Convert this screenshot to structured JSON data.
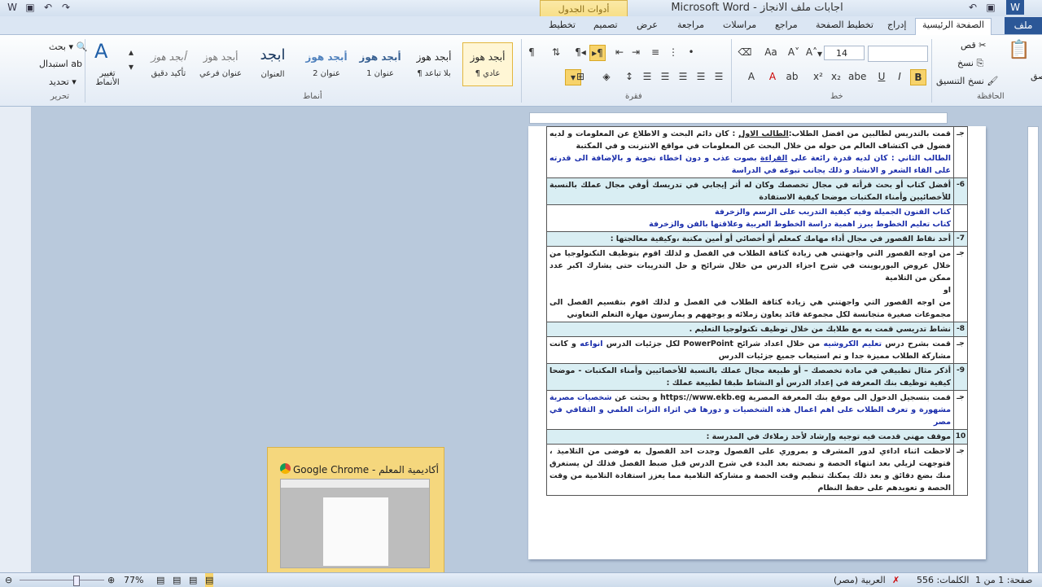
{
  "window": {
    "title": "اجابات ملف الانجاز - Microsoft Word",
    "table_tools": "أدوات الجدول"
  },
  "tabs": {
    "file": "ملف",
    "items": [
      {
        "label": "الصفحة الرئيسية",
        "active": true
      },
      {
        "label": "إدراج"
      },
      {
        "label": "تخطيط الصفحة"
      },
      {
        "label": "مراجع"
      },
      {
        "label": "مراسلات"
      },
      {
        "label": "مراجعة"
      },
      {
        "label": "عرض"
      },
      {
        "label": "تصميم"
      },
      {
        "label": "تخطيط"
      }
    ]
  },
  "ribbon": {
    "clipboard": {
      "label": "الحافظة",
      "cut": "قص",
      "copy": "نسخ",
      "format_painter": "نسخ التنسيق",
      "paste": "لصق"
    },
    "font": {
      "label": "خط",
      "size": "14",
      "bold": "B",
      "italic": "I",
      "underline": "U",
      "strike": "abe",
      "subscript": "x₂",
      "superscript": "x²"
    },
    "paragraph": {
      "label": "فقرة"
    },
    "styles": {
      "label": "أنماط",
      "items": [
        {
          "preview": "أبجد هوز",
          "name": "¶ عادي",
          "selected": true
        },
        {
          "preview": "أبجد هوز",
          "name": "¶ بلا تباعد"
        },
        {
          "preview": "أبجد هوز",
          "name": "عنوان 1"
        },
        {
          "preview": "أبجد هوز",
          "name": "عنوان 2"
        },
        {
          "preview": "ابجد",
          "name": "العنوان"
        },
        {
          "preview": "أبجد هوز",
          "name": "عنوان فرعي"
        },
        {
          "preview": "أبجد هوز",
          "name": "تأكيد دقيق"
        }
      ],
      "change_styles": "تغيير الأنماط"
    },
    "editing": {
      "label": "تحرير",
      "find": "بحث",
      "replace": "استبدال",
      "select": "تحديد"
    }
  },
  "document": {
    "rows": [
      {
        "num": "جـ",
        "type": "a",
        "parts": [
          {
            "t": "قمت بالتدريس لطالبين من افضل الطلاب:"
          },
          {
            "t": "الطالب الاول",
            "u": true
          },
          {
            "t": " : كان دائم البحث و الاطلاع عن المعلومات و لديه فضول في اكتشاف العالم من حوله من خلال البحث عن المعلومات في مواقع الانترنت و في المكتبة"
          },
          {
            "br": true
          },
          {
            "t": "الطالب الثاني : كان لديه قدرة رائعة على ",
            "c": "blue"
          },
          {
            "t": "القراءة",
            "c": "blue",
            "u": true
          },
          {
            "t": " بصوت عذب و دون اخطاء نحوية و بالإضافة الى قدرته على القاء الشعر و الانشاد و ذلك يجانب تبوغه في الدراسة",
            "c": "blue"
          }
        ]
      },
      {
        "num": "6-",
        "type": "q",
        "parts": [
          {
            "t": "أفضل كتاب أو بحث قرأته في مجال تخصصك وكان له أثر إيجابي في تدريسك أوفي مجال عملك بالنسبة للأخصائيين وأمناء المكتبات موضحا كيفية الاستفادة"
          }
        ]
      },
      {
        "num": "",
        "type": "a",
        "parts": [
          {
            "t": "كتاب الفنون الجميلة وفيه كيفية التدريب على الرسم والزخرفة",
            "c": "blue"
          },
          {
            "br": true
          },
          {
            "t": "كتاب  تعليم الخطوط   يبرز اهمية دراسة الخطوط العربية وعلاقتها بالفن  والزخرفة",
            "c": "blue"
          },
          {
            "br": true
          },
          {
            "t": " "
          }
        ]
      },
      {
        "num": "7-",
        "type": "q",
        "parts": [
          {
            "t": "أحد نقاط القصور في مجال أداء مهامك كمعلم أو أخصائي أو أمين مكتبة ،وكيفية معالجتها :"
          }
        ]
      },
      {
        "num": "جـ",
        "type": "a",
        "parts": [
          {
            "t": "من اوجه القصور التي واجهتني  هي زيادة كثافة الطلاب في الفصل و لذلك اقوم بتوظيف التكنولوجيا من خلال عروض البوربوينت في شرح اجزاء الدرس من خلال شرائح و حل التدريبات حتى يشارك اكبر عدد ممكن من التلامية"
          },
          {
            "br": true
          },
          {
            "t": "او"
          },
          {
            "br": true
          },
          {
            "t": "من اوجه القصور التي واجهتني  هي زيادة كثافة الطلاب في الفصل و لذلك اقوم بتقسيم الفصل الى مجموعات صغيرة متجانسة لكل مجموعة قائد يعاون زملائه و يوجههم و يمارسون مهارة التعلم التعاوني"
          },
          {
            "br": true
          },
          {
            "t": " "
          }
        ]
      },
      {
        "num": "8-",
        "type": "q",
        "parts": [
          {
            "t": "نشاط تدريسي قمت به مع طلابك من خلال توظيف تكنولوجيا التعليم ."
          }
        ]
      },
      {
        "num": "جـ",
        "type": "a",
        "parts": [
          {
            "t": "قمت بشرح درس "
          },
          {
            "t": "تعليم الكروشيه",
            "c": "blue"
          },
          {
            "t": " من خلال اعداد شرائح PowerPoint  لكل جزئيات الدرس "
          },
          {
            "t": "انواعه",
            "c": "blue"
          },
          {
            "t": " و كانت مشاركة الطلاب مميزة جدا و تم استيعاب جميع جزئيات الدرس"
          }
        ]
      },
      {
        "num": "9-",
        "type": "q",
        "parts": [
          {
            "t": "أذكر مثال تطبيقي في مادة تخصصك – أو طبيعة مجال عملك بالنسبة للأخصائيين وأمناء المكتبات - موضحا كيفية توظيف بنك المعرفة في إعداد الدرس أو النشاط طبقا لطبيعة عملك :"
          }
        ]
      },
      {
        "num": "جـ",
        "type": "a",
        "parts": [
          {
            "t": "قمت بتسجيل الدخول الى موقع بنك المعرفة المصرية https://www.ekb.eg و بحثت عن "
          },
          {
            "t": "شخصيات مصرية مشهورة و تعرف الطلاب على اهم اعمال هذه الشخصيات و دورها في اثراء التراث العلمي و الثقافي في مصر",
            "c": "blue"
          }
        ]
      },
      {
        "num": "10",
        "type": "q",
        "parts": [
          {
            "t": "موقف مهني قدمت فيه توجيه وإرشاد لأحد زملاءك في المدرسة :"
          }
        ]
      },
      {
        "num": "جـ",
        "type": "a",
        "parts": [
          {
            "t": "لاحظت اثناء اداءي لدور المشرف و بمروري على الفصول وجدت احد الفصول به فوضى من التلاميذ ، فتوجهت لزيلي بعد انتهاء الحصة و نصحته بعد البدء في شرح الدرس قبل ضبط الفصل فذلك لن يستغرق منك بضع دقائق و بعد ذلك يمكنك تنظيم وقت الحصة و مشاركة التلامية مما يعزز استفادة التلامية من وقت الحصة و تعويدهم على حفظ النظام"
          }
        ]
      }
    ]
  },
  "taskbar_preview": {
    "title": "أكاديمية المعلم - Google Chrome"
  },
  "status": {
    "page": "صفحة: 1 من 1",
    "words": "الكلمات: 556",
    "language": "العربية (مصر)",
    "zoom": "77%"
  }
}
